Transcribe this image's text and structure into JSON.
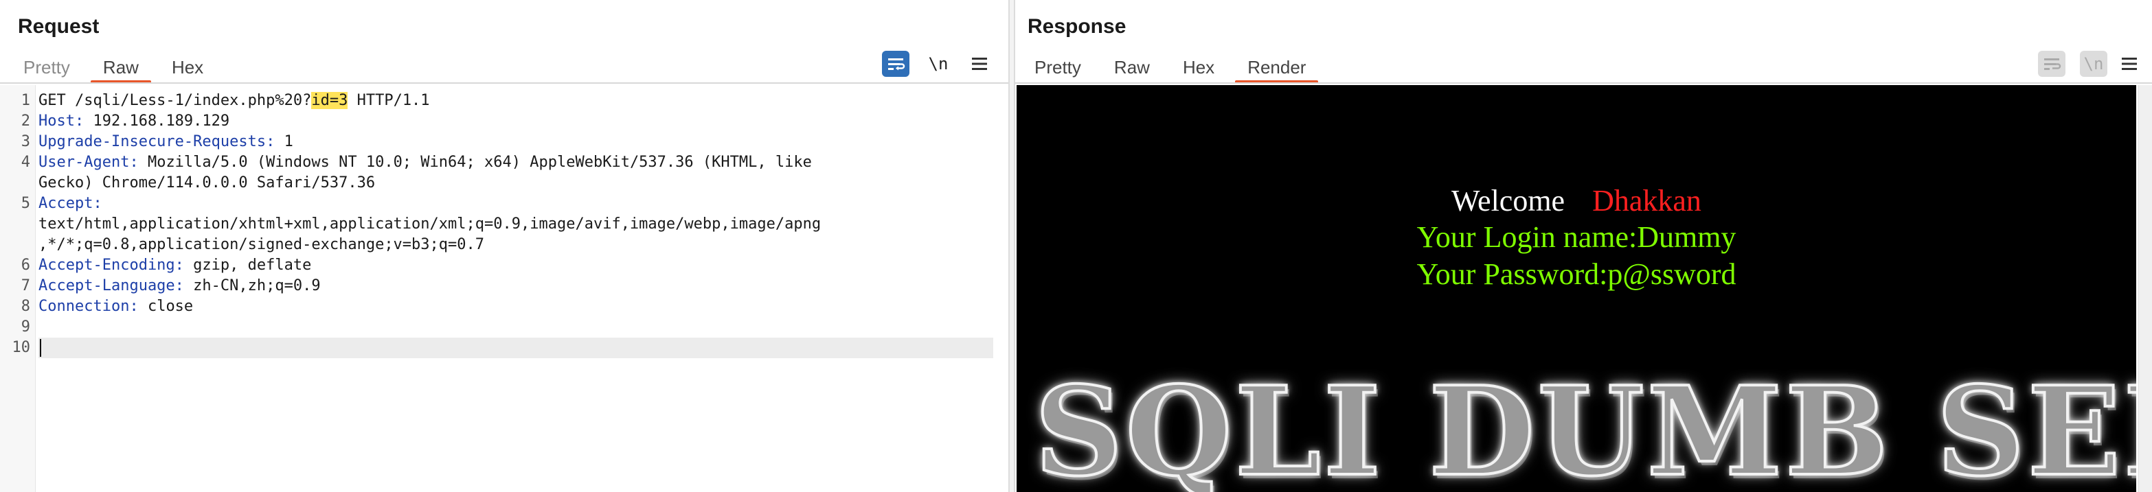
{
  "request": {
    "title": "Request",
    "tabs": [
      {
        "label": "Pretty",
        "state": "disabled"
      },
      {
        "label": "Raw",
        "state": "active"
      },
      {
        "label": "Hex",
        "state": "normal"
      }
    ],
    "tools": {
      "newline_label": "\\n"
    },
    "lines": [
      {
        "n": "1",
        "parts": [
          {
            "t": "GET /sqli/Less-1/index.php%20?"
          },
          {
            "t": "id=3",
            "hl": true
          },
          {
            "t": " HTTP/1.1"
          }
        ]
      },
      {
        "n": "2",
        "parts": [
          {
            "t": "Host:",
            "key": true
          },
          {
            "t": " 192.168.189.129"
          }
        ]
      },
      {
        "n": "3",
        "parts": [
          {
            "t": "Upgrade-Insecure-Requests:",
            "key": true
          },
          {
            "t": " 1"
          }
        ]
      },
      {
        "n": "4",
        "parts": [
          {
            "t": "User-Agent:",
            "key": true
          },
          {
            "t": " Mozilla/5.0 (Windows NT 10.0; Win64; x64) AppleWebKit/537.36 (KHTML, like"
          }
        ]
      },
      {
        "n": "",
        "parts": [
          {
            "t": "Gecko) Chrome/114.0.0.0 Safari/537.36"
          }
        ]
      },
      {
        "n": "5",
        "parts": [
          {
            "t": "Accept:",
            "key": true
          }
        ]
      },
      {
        "n": "",
        "parts": [
          {
            "t": "text/html,application/xhtml+xml,application/xml;q=0.9,image/avif,image/webp,image/apng"
          }
        ]
      },
      {
        "n": "",
        "parts": [
          {
            "t": ",*/*;q=0.8,application/signed-exchange;v=b3;q=0.7"
          }
        ]
      },
      {
        "n": "6",
        "parts": [
          {
            "t": "Accept-Encoding:",
            "key": true
          },
          {
            "t": " gzip, deflate"
          }
        ]
      },
      {
        "n": "7",
        "parts": [
          {
            "t": "Accept-Language:",
            "key": true
          },
          {
            "t": " zh-CN,zh;q=0.9"
          }
        ]
      },
      {
        "n": "8",
        "parts": [
          {
            "t": "Connection:",
            "key": true
          },
          {
            "t": " close"
          }
        ]
      },
      {
        "n": "9",
        "parts": []
      },
      {
        "n": "10",
        "parts": [],
        "current": true
      }
    ]
  },
  "response": {
    "title": "Response",
    "tabs": [
      {
        "label": "Pretty",
        "state": "normal"
      },
      {
        "label": "Raw",
        "state": "normal"
      },
      {
        "label": "Hex",
        "state": "normal"
      },
      {
        "label": "Render",
        "state": "active"
      }
    ],
    "tools": {
      "newline_label": "\\n"
    },
    "render": {
      "welcome": "Welcome",
      "name": "Dhakkan",
      "login": "Your Login name:Dummy",
      "password": "Your Password:p@ssword",
      "banner": "SQLI DUMB SERIES"
    }
  },
  "colors": {
    "accent": "#e8562a",
    "brand_blue": "#2f6fb8",
    "header_key": "#1d3fa8",
    "highlight": "#ffe35a",
    "render_green": "#7fff00",
    "render_red": "#ff2020"
  },
  "icons": {
    "wrap": "wrap-lines-icon",
    "menu": "hamburger-menu-icon",
    "layout": [
      "split-horizontal-icon",
      "split-vertical-icon",
      "single-pane-icon"
    ]
  }
}
